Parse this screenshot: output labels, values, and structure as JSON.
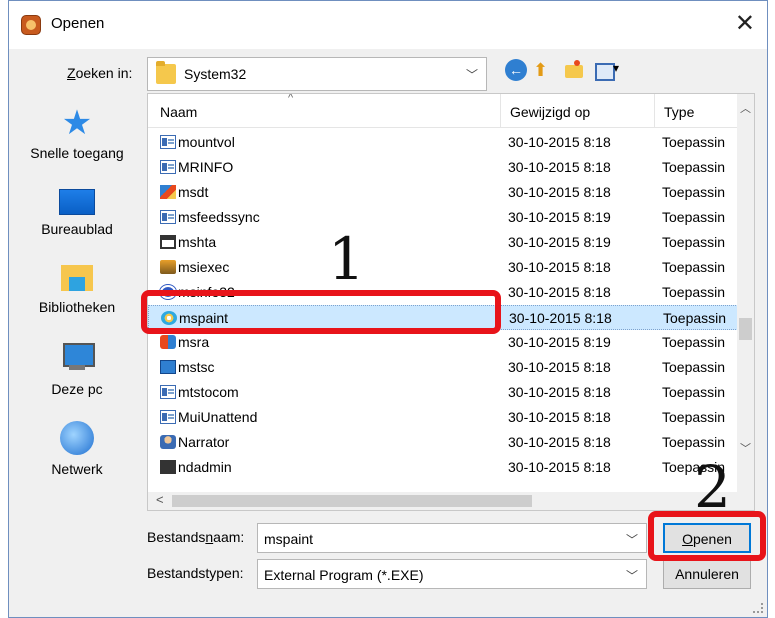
{
  "window": {
    "title": "Openen",
    "close_label": "✕"
  },
  "lookin": {
    "label_pre": "Z",
    "label_post": "oeken in:",
    "value": "System32"
  },
  "toolbar": {
    "back_icon": "back-arrow-icon",
    "up_icon": "up-folder-icon",
    "new_folder_icon": "new-folder-icon",
    "view_icon": "view-menu-icon"
  },
  "places": [
    {
      "label": "Snelle toegang",
      "icon": "star-icon"
    },
    {
      "label": "Bureaublad",
      "icon": "desktop-icon"
    },
    {
      "label": "Bibliotheken",
      "icon": "libraries-icon"
    },
    {
      "label": "Deze pc",
      "icon": "computer-icon"
    },
    {
      "label": "Netwerk",
      "icon": "network-icon"
    }
  ],
  "columns": {
    "name": "Naam",
    "modified": "Gewijzigd op",
    "type": "Type"
  },
  "files": [
    {
      "name": "mountvol",
      "date": "30-10-2015 8:18",
      "type": "Toepassin",
      "icon": "exe"
    },
    {
      "name": "MRINFO",
      "date": "30-10-2015 8:18",
      "type": "Toepassin",
      "icon": "exe"
    },
    {
      "name": "msdt",
      "date": "30-10-2015 8:18",
      "type": "Toepassin",
      "icon": "color"
    },
    {
      "name": "msfeedssync",
      "date": "30-10-2015 8:19",
      "type": "Toepassin",
      "icon": "exe"
    },
    {
      "name": "mshta",
      "date": "30-10-2015 8:19",
      "type": "Toepassin",
      "icon": "app"
    },
    {
      "name": "msiexec",
      "date": "30-10-2015 8:18",
      "type": "Toepassin",
      "icon": "pkg"
    },
    {
      "name": "msinfo32",
      "date": "30-10-2015 8:18",
      "type": "Toepassin",
      "icon": "info"
    },
    {
      "name": "mspaint",
      "date": "30-10-2015 8:18",
      "type": "Toepassin",
      "icon": "paint",
      "selected": true
    },
    {
      "name": "msra",
      "date": "30-10-2015 8:19",
      "type": "Toepassin",
      "icon": "people"
    },
    {
      "name": "mstsc",
      "date": "30-10-2015 8:18",
      "type": "Toepassin",
      "icon": "rdp"
    },
    {
      "name": "mtstocom",
      "date": "30-10-2015 8:18",
      "type": "Toepassin",
      "icon": "exe"
    },
    {
      "name": "MuiUnattend",
      "date": "30-10-2015 8:18",
      "type": "Toepassin",
      "icon": "exe"
    },
    {
      "name": "Narrator",
      "date": "30-10-2015 8:18",
      "type": "Toepassin",
      "icon": "narr"
    },
    {
      "name": "ndadmin",
      "date": "30-10-2015 8:18",
      "type": "Toepassin",
      "icon": "ndad"
    }
  ],
  "filename": {
    "label_pre": "Bestands",
    "label_u": "n",
    "label_post": "aam:",
    "value": "mspaint"
  },
  "filetype": {
    "label": "Bestandstypen:",
    "value": "External Program (*.EXE)"
  },
  "buttons": {
    "open_u": "O",
    "open_rest": "penen",
    "cancel": "Annuleren"
  },
  "annotations": {
    "step1": "1",
    "step2": "2"
  },
  "colors": {
    "annotation": "#e8141a",
    "selection": "#cce8ff",
    "accent": "#0078d7"
  }
}
